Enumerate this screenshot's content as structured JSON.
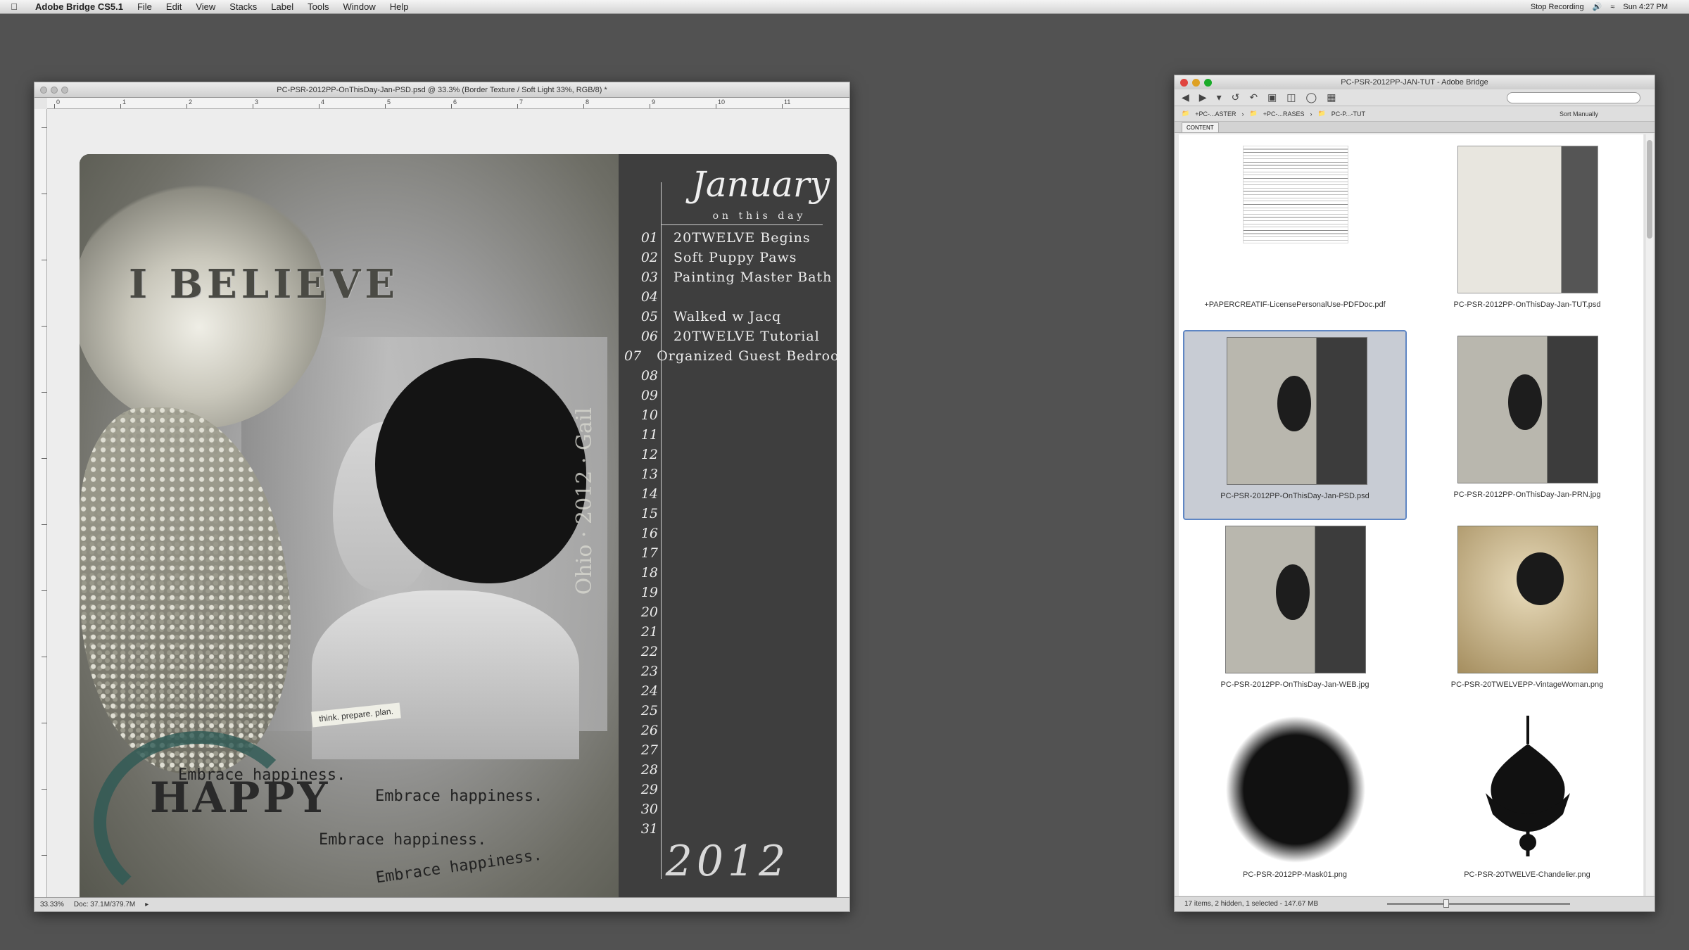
{
  "menubar": {
    "app_name": "Adobe Bridge CS5.1",
    "items": [
      "File",
      "Edit",
      "View",
      "Stacks",
      "Label",
      "Tools",
      "Window",
      "Help"
    ],
    "status_recording": "Stop Recording",
    "clock": "Sun 4:27 PM"
  },
  "photoshop": {
    "title": "PC-PSR-2012PP-OnThisDay-Jan-PSD.psd @ 33.3% (Border Texture / Soft Light 33%, RGB/8) *",
    "ruler_labels": [
      "0",
      "1",
      "2",
      "3",
      "4",
      "5",
      "6",
      "7",
      "8",
      "9",
      "10",
      "11"
    ],
    "status_zoom": "33.33%",
    "status_doc": "Doc: 37.1M/379.7M",
    "artwork": {
      "believe_text": "I BELIEVE",
      "tag_text": "think. prepare. plan.",
      "happy_text": "HAPPY",
      "embrace_lines": [
        "Embrace happiness.",
        "Embrace happiness.",
        "Embrace happiness.",
        "Embrace happiness."
      ],
      "vertical_text": "Ohio · 2012 · Gail",
      "calendar": {
        "month": "January",
        "subtitle": "on this day",
        "days": [
          {
            "num": "01",
            "event": "20TWELVE Begins"
          },
          {
            "num": "02",
            "event": "Soft Puppy Paws"
          },
          {
            "num": "03",
            "event": "Painting Master Bath"
          },
          {
            "num": "04",
            "event": ""
          },
          {
            "num": "05",
            "event": "Walked w Jacq"
          },
          {
            "num": "06",
            "event": "20TWELVE Tutorial"
          },
          {
            "num": "07",
            "event": "Organized Guest Bedroom"
          },
          {
            "num": "08",
            "event": ""
          },
          {
            "num": "09",
            "event": ""
          },
          {
            "num": "10",
            "event": ""
          },
          {
            "num": "11",
            "event": ""
          },
          {
            "num": "12",
            "event": ""
          },
          {
            "num": "13",
            "event": ""
          },
          {
            "num": "14",
            "event": ""
          },
          {
            "num": "15",
            "event": ""
          },
          {
            "num": "16",
            "event": ""
          },
          {
            "num": "17",
            "event": ""
          },
          {
            "num": "18",
            "event": ""
          },
          {
            "num": "19",
            "event": ""
          },
          {
            "num": "20",
            "event": ""
          },
          {
            "num": "21",
            "event": ""
          },
          {
            "num": "22",
            "event": ""
          },
          {
            "num": "23",
            "event": ""
          },
          {
            "num": "24",
            "event": ""
          },
          {
            "num": "25",
            "event": ""
          },
          {
            "num": "26",
            "event": ""
          },
          {
            "num": "27",
            "event": ""
          },
          {
            "num": "28",
            "event": ""
          },
          {
            "num": "29",
            "event": ""
          },
          {
            "num": "30",
            "event": ""
          },
          {
            "num": "31",
            "event": ""
          }
        ],
        "year": "2012"
      }
    }
  },
  "bridge": {
    "title": "PC-PSR-2012PP-JAN-TUT - Adobe Bridge",
    "search_placeholder": "",
    "path": [
      "+PC-...ASTER",
      "+PC-...RASES",
      "PC-P...-TUT"
    ],
    "sort_label": "Sort Manually",
    "tab_label": "CONTENT",
    "files": [
      {
        "name": "+PAPERCREATIF-LicensePersonalUse-PDFDoc.pdf",
        "kind": "doc",
        "selected": false
      },
      {
        "name": "PC-PSR-2012PP-OnThisDay-Jan-TUT.psd",
        "kind": "blank",
        "selected": false
      },
      {
        "name": "PC-PSR-2012PP-OnThisDay-Jan-PSD.psd",
        "kind": "cal",
        "selected": true
      },
      {
        "name": "PC-PSR-2012PP-OnThisDay-Jan-PRN.jpg",
        "kind": "cal",
        "selected": false
      },
      {
        "name": "PC-PSR-2012PP-OnThisDay-Jan-WEB.jpg",
        "kind": "cal",
        "selected": false
      },
      {
        "name": "PC-PSR-20TWELVEPP-VintageWoman.png",
        "kind": "vint",
        "selected": false
      },
      {
        "name": "PC-PSR-2012PP-Mask01.png",
        "kind": "mask",
        "selected": false
      },
      {
        "name": "PC-PSR-20TWELVE-Chandelier.png",
        "kind": "chand",
        "selected": false
      }
    ],
    "status": "17 items, 2 hidden, 1 selected - 147.67 MB",
    "colors": {
      "selection": "#5f86c4",
      "close": "#e0443e",
      "minimize": "#dea123",
      "zoom": "#1aab29"
    }
  }
}
